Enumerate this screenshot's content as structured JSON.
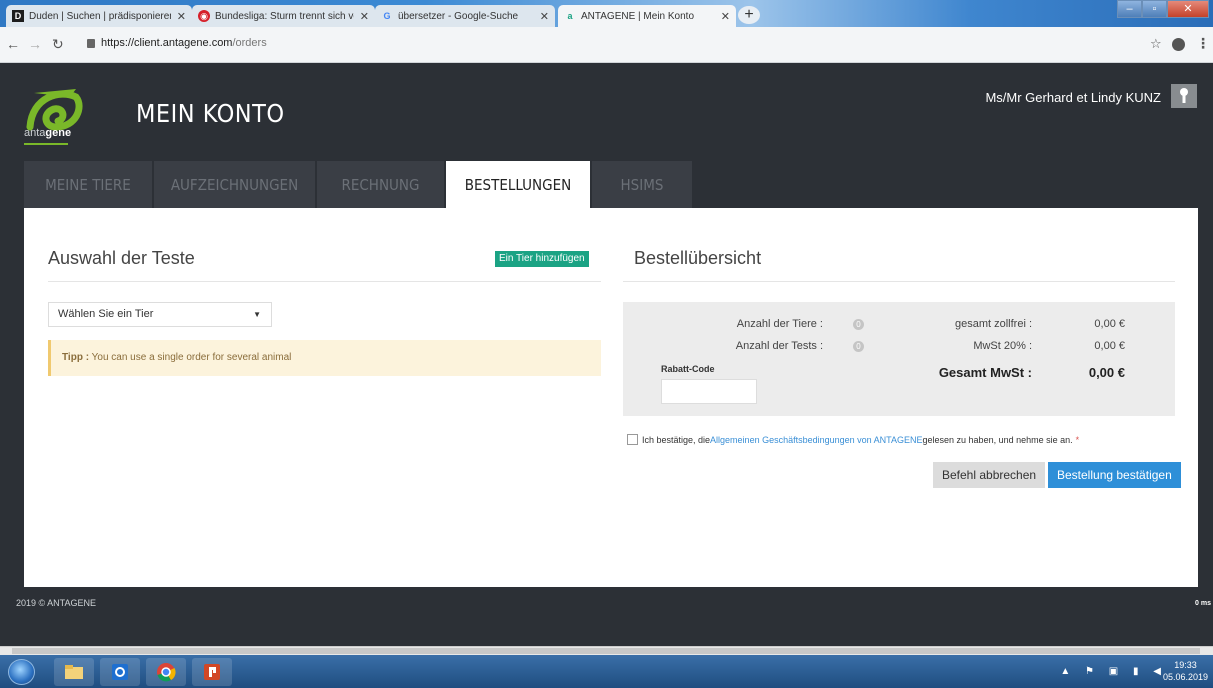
{
  "browser": {
    "tabs": [
      {
        "label": "Duden | Suchen | prädisponieren",
        "favicon": "D"
      },
      {
        "label": "Bundesliga: Sturm trennt sich von",
        "favicon": "◉"
      },
      {
        "label": "übersetzer - Google-Suche",
        "favicon": "G"
      },
      {
        "label": "ANTAGENE | Mein Konto",
        "favicon": "a"
      }
    ],
    "url_host": "https://client.antagene.com",
    "url_path": "/orders"
  },
  "header": {
    "logo_text_pre": "anta",
    "logo_text_bold": "gene",
    "title": "MEIN KONTO",
    "user_name": "Ms/Mr Gerhard et Lindy KUNZ"
  },
  "nav": {
    "tabs": [
      "MEINE TIERE",
      "AUFZEICHNUNGEN",
      "RECHNUNG",
      "BESTELLUNGEN",
      "HSIMS"
    ]
  },
  "left": {
    "title": "Auswahl der Teste",
    "add_button": "Ein Tier hinzufügen",
    "select_value": "Wählen Sie ein Tier",
    "tip_label": "Tipp :",
    "tip_text": " You can use a single order for several animal"
  },
  "right": {
    "title": "Bestellübersicht",
    "animals_label": "Anzahl der Tiere :",
    "tests_label": "Anzahl der Tests :",
    "info_icon": "0",
    "net_label": "gesamt zollfrei :",
    "net_value": "0,00 €",
    "vat_label": "MwSt 20% :",
    "vat_value": "0,00 €",
    "total_label": "Gesamt MwSt :",
    "total_value": "0,00 €",
    "rabatt_label": "Rabatt-Code",
    "confirm_pre": "Ich bestätige, die ",
    "confirm_link": "Allgemeinen Geschäftsbedingungen von ANTAGENE",
    "confirm_post": " gelesen zu haben, und nehme sie an.",
    "required_mark": "*",
    "cancel_button": "Befehl abbrechen",
    "submit_button": "Bestellung bestätigen"
  },
  "footer": {
    "copyright": "2019 © ANTAGENE",
    "timing": "0 ms"
  },
  "taskbar": {
    "time": "19:33",
    "date": "05.06.2019"
  },
  "colors": {
    "accent_green": "#1ba384",
    "brand_green": "#7ab829",
    "primary_blue": "#2e8fd8",
    "dark_bg": "#2c3036"
  }
}
